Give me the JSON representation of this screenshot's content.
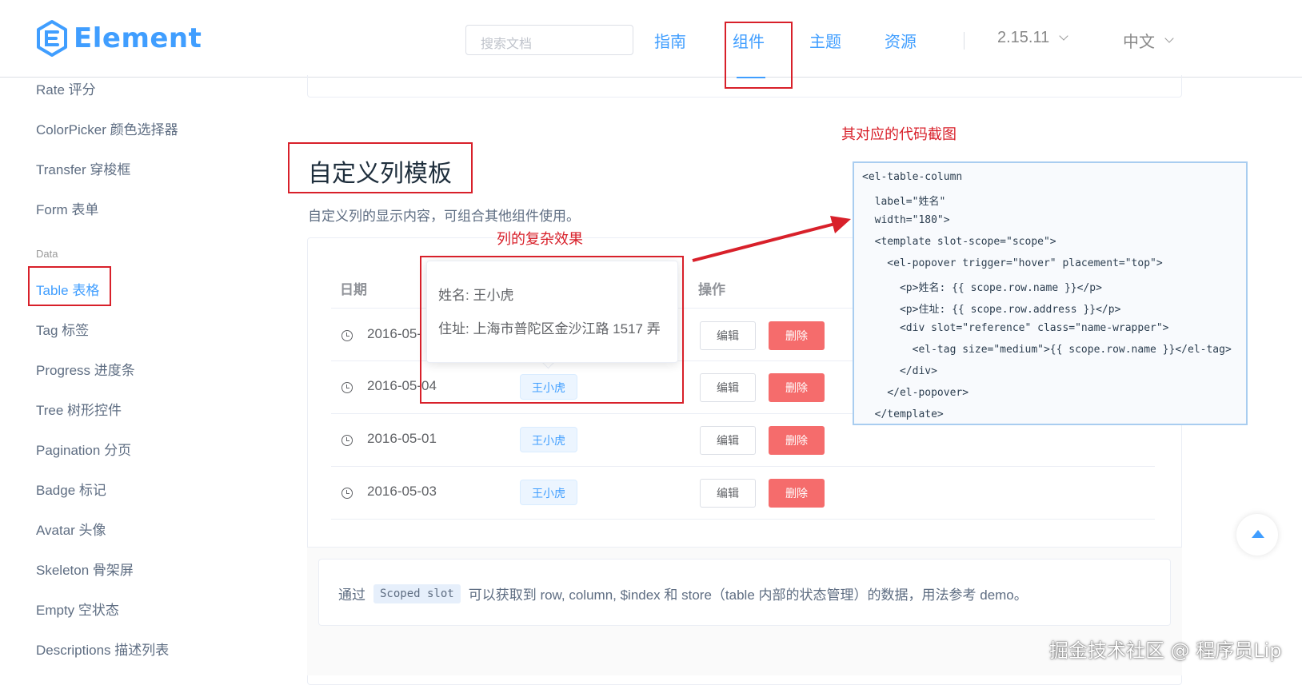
{
  "header": {
    "logo_text": "Element",
    "search_placeholder": "搜索文档",
    "nav": [
      "指南",
      "组件",
      "主题",
      "资源"
    ],
    "version": "2.15.11",
    "language": "中文"
  },
  "sidebar": {
    "items_top": [
      "Rate 评分",
      "ColorPicker 颜色选择器",
      "Transfer 穿梭框",
      "Form 表单"
    ],
    "group_label": "Data",
    "items_data": [
      "Table 表格",
      "Tag 标签",
      "Progress 进度条",
      "Tree 树形控件",
      "Pagination 分页",
      "Badge 标记",
      "Avatar 头像",
      "Skeleton 骨架屏",
      "Empty 空状态",
      "Descriptions 描述列表"
    ]
  },
  "main": {
    "title": "自定义列模板",
    "description": "自定义列的显示内容，可组合其他组件使用。",
    "table": {
      "headers": [
        "日期",
        "操作"
      ],
      "rows": [
        {
          "date": "2016-05-",
          "name": "王小虎"
        },
        {
          "date": "2016-05-04",
          "name": "王小虎"
        },
        {
          "date": "2016-05-01",
          "name": "王小虎"
        },
        {
          "date": "2016-05-03",
          "name": "王小虎"
        }
      ],
      "edit_label": "编辑",
      "delete_label": "删除"
    },
    "popover": {
      "name": "姓名: 王小虎",
      "address": "住址: 上海市普陀区金沙江路 1517 弄"
    },
    "tip": {
      "prefix": "通过",
      "code": "Scoped slot",
      "suffix": "可以获取到 row, column, $index 和 store（table 内部的状态管理）的数据，用法参考 demo。"
    }
  },
  "annotations": {
    "code_caption": "其对应的代码截图",
    "effect_caption": "列的复杂效果"
  },
  "code_lines": [
    "<el-table-column",
    "  label=\"姓名\"",
    "  width=\"180\">",
    "  <template slot-scope=\"scope\">",
    "    <el-popover trigger=\"hover\" placement=\"top\">",
    "      <p>姓名: {{ scope.row.name }}</p>",
    "      <p>住址: {{ scope.row.address }}</p>",
    "      <div slot=\"reference\" class=\"name-wrapper\">",
    "        <el-tag size=\"medium\">{{ scope.row.name }}</el-tag>",
    "      </div>",
    "    </el-popover>",
    "  </template>"
  ],
  "watermark": "掘金技术社区 @ 程序员Lip",
  "colors": {
    "primary": "#409eff",
    "danger": "#f56c6c",
    "annotation_red": "#d8202a"
  }
}
